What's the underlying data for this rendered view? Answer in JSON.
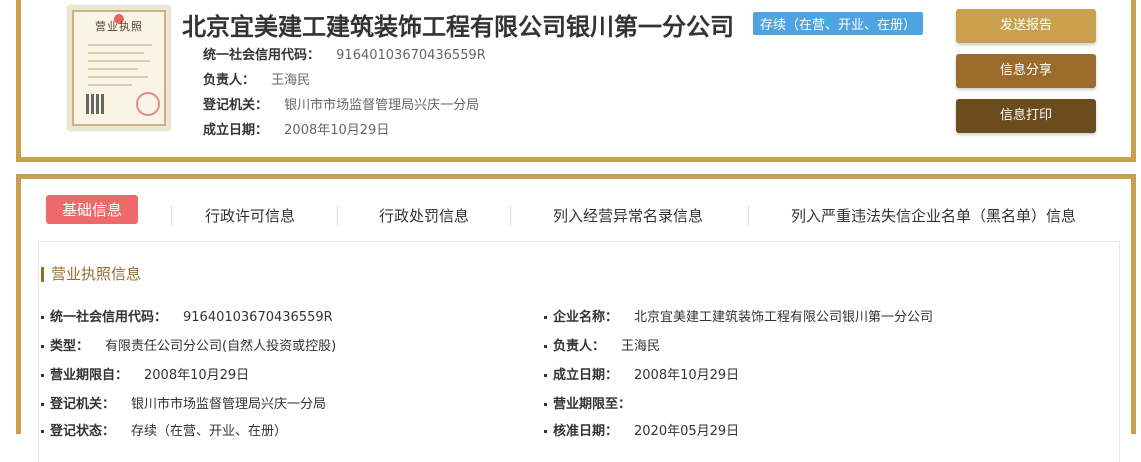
{
  "company": {
    "name": "北京宜美建工建筑装饰工程有限公司银川第一分公司",
    "status": "存续（在营、开业、在册）",
    "license_lines": [
      "营业执照"
    ],
    "summary": [
      {
        "label": "统一社会信用代码：",
        "value": "91640103670436559R"
      },
      {
        "label": "负责人：",
        "value": "王海民"
      },
      {
        "label": "登记机关：",
        "value": "银川市市场监督管理局兴庆一分局"
      },
      {
        "label": "成立日期：",
        "value": "2008年10月29日"
      }
    ]
  },
  "actions": {
    "report": "发送报告",
    "share": "信息分享",
    "print": "信息打印"
  },
  "tabs": [
    "基础信息",
    "行政许可信息",
    "行政处罚信息",
    "列入经营异常名录信息",
    "列入严重违法失信企业名单（黑名单）信息"
  ],
  "section": {
    "title": "营业执照信息",
    "left": [
      {
        "label": "统一社会信用代码：",
        "value": "91640103670436559R"
      },
      {
        "label": "类型：",
        "value": "有限责任公司分公司(自然人投资或控股)"
      },
      {
        "label": "营业期限自：",
        "value": "2008年10月29日"
      },
      {
        "label": "登记机关：",
        "value": "银川市市场监督管理局兴庆一分局"
      },
      {
        "label": "登记状态：",
        "value": "存续（在营、开业、在册）"
      }
    ],
    "right": [
      {
        "label": "企业名称：",
        "value": "北京宜美建工建筑装饰工程有限公司银川第一分公司"
      },
      {
        "label": "负责人：",
        "value": "王海民"
      },
      {
        "label": "成立日期：",
        "value": "2008年10月29日"
      },
      {
        "label": "营业期限至：",
        "value": ""
      },
      {
        "label": "核准日期：",
        "value": "2020年05月29日"
      }
    ]
  }
}
